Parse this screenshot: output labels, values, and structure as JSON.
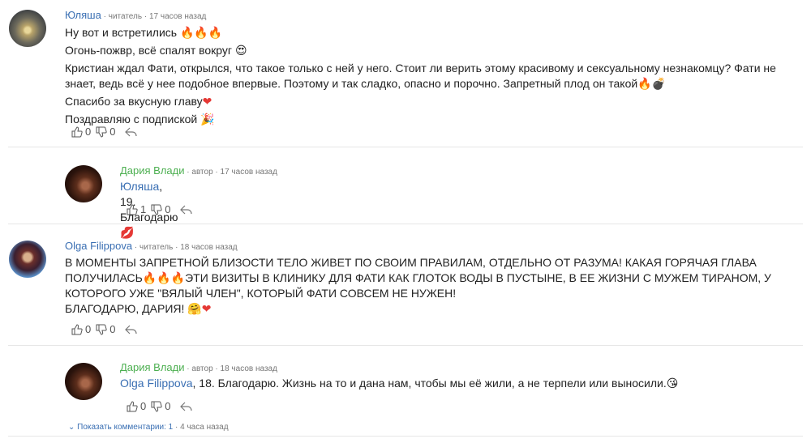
{
  "comments": [
    {
      "author": "Юляша",
      "meta": " · читатель · 17 часов назад",
      "lines": [
        "Ну вот и встретились ",
        "Огонь-пожвр, всё спалят вокруг ",
        "Кристиан ждал Фати, открылся, что такое только с ней у него. Стоит ли верить этому красивому и сексуальному незнакомцу? Фати не знает, ведь всё у нее подобное впервые. Поэтому и так сладко, опасно и порочно. Запретный плод он такой",
        "Спасибо за вкусную главу",
        "Поздравляю с подпиской "
      ],
      "likes": "0",
      "dislikes": "0"
    },
    {
      "author": "Дария Влади",
      "meta": " · автор · 17 часов назад",
      "mention": "Юляша",
      "text": ", 19. Благодарю",
      "likes": "1",
      "dislikes": "0"
    },
    {
      "author": "Olga Filippova",
      "meta": " · читатель · 18 часов назад",
      "text": "В МОМЕНТЫ ЗАПРЕТНОЙ БЛИЗОСТИ ТЕЛО ЖИВЕТ ПО СВОИМ ПРАВИЛАМ, ОТДЕЛЬНО ОТ РАЗУМА! КАКАЯ ГОРЯЧАЯ ГЛАВА ПОЛУЧИЛАСЬ",
      "text2": "ЭТИ ВИЗИТЫ В КЛИНИКУ ДЛЯ ФАТИ КАК ГЛОТОК ВОДЫ В ПУСТЫНЕ, В ЕЕ ЖИЗНИ С МУЖЕМ ТИРАНОМ, У КОТОРОГО УЖЕ \"ВЯЛЫЙ ЧЛЕН\", КОТОРЫЙ ФАТИ СОВСЕМ НЕ НУЖЕН!",
      "text3": "БЛАГОДАРЮ, ДАРИЯ! ",
      "likes": "0",
      "dislikes": "0"
    },
    {
      "author": "Дария Влади",
      "meta": " · автор · 18 часов назад",
      "mention": "Olga Filippova",
      "text": ", 18. Благодарю. Жизнь на то и дана нам, чтобы мы её жили, а не терпели или выносили.",
      "likes": "0",
      "dislikes": "0"
    }
  ],
  "show_comments": {
    "label": "Показать комментарии: 1",
    "time": " · 4 часа назад"
  }
}
